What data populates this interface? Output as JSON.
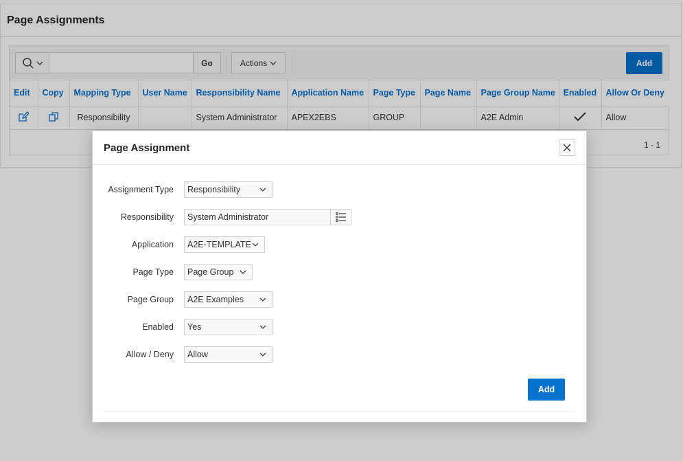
{
  "page": {
    "region_title": "Page Assignments"
  },
  "toolbar": {
    "search_placeholder": "",
    "go_label": "Go",
    "actions_label": "Actions",
    "add_label": "Add"
  },
  "report": {
    "columns": [
      "Edit",
      "Copy",
      "Mapping Type",
      "User Name",
      "Responsibility Name",
      "Application Name",
      "Page Type",
      "Page Name",
      "Page Group Name",
      "Enabled",
      "Allow Or Deny"
    ],
    "rows": [
      {
        "mapping_type": "Responsibility",
        "user_name": "",
        "responsibility_name": "System Administrator",
        "application_name": "APEX2EBS",
        "page_type": "GROUP",
        "page_name": "",
        "page_group_name": "A2E Admin",
        "enabled_icon": "check-icon",
        "allow_or_deny": "Allow"
      }
    ],
    "pagination": "1 - 1"
  },
  "dialog": {
    "title": "Page Assignment",
    "fields": {
      "assignment_type": {
        "label": "Assignment Type",
        "value": "Responsibility"
      },
      "responsibility": {
        "label": "Responsibility",
        "value": "System Administrator"
      },
      "application": {
        "label": "Application",
        "value": "A2E-TEMPLATE"
      },
      "page_type": {
        "label": "Page Type",
        "value": "Page Group"
      },
      "page_group": {
        "label": "Page Group",
        "value": "A2E Examples"
      },
      "enabled": {
        "label": "Enabled",
        "value": "Yes"
      },
      "allow_deny": {
        "label": "Allow / Deny",
        "value": "Allow"
      }
    },
    "add_label": "Add"
  },
  "colors": {
    "accent": "#0572ce",
    "overlay": "rgba(0,0,0,0.2)"
  }
}
